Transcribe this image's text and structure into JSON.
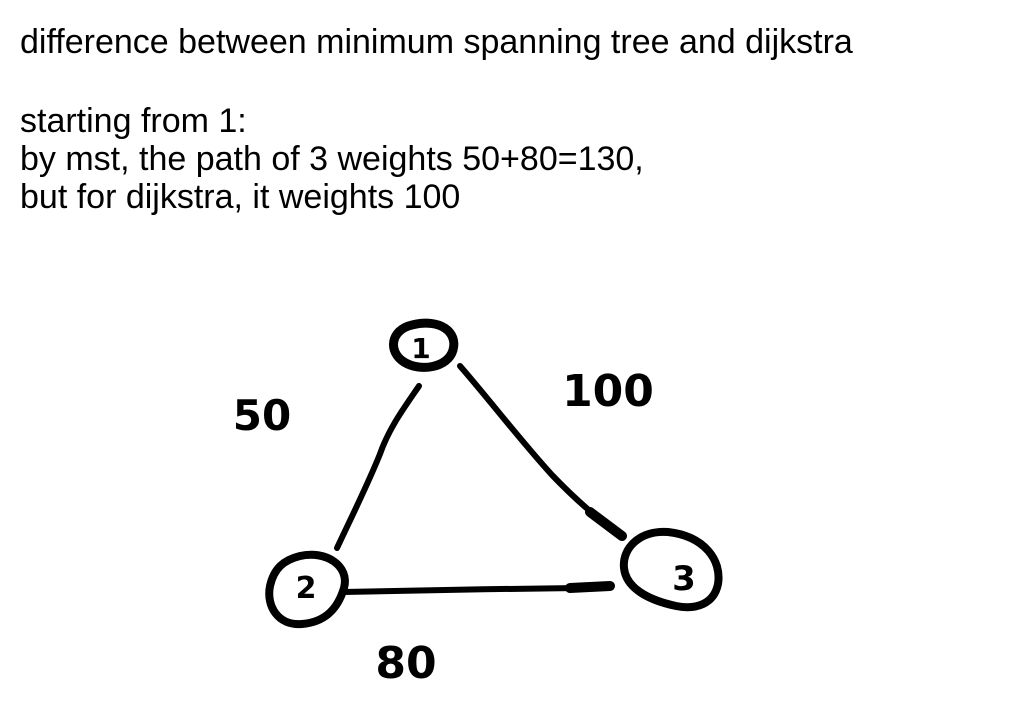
{
  "title": "difference between minimum spanning tree and dijkstra",
  "notes": [
    "starting from 1:",
    "by mst, the path of 3 weights 50+80=130,",
    "but for dijkstra, it weights 100"
  ],
  "graph": {
    "nodes": [
      {
        "id": "1",
        "label": "1"
      },
      {
        "id": "2",
        "label": "2"
      },
      {
        "id": "3",
        "label": "3"
      }
    ],
    "edges": [
      {
        "from": "1",
        "to": "2",
        "weight": "50"
      },
      {
        "from": "1",
        "to": "3",
        "weight": "100"
      },
      {
        "from": "2",
        "to": "3",
        "weight": "80"
      }
    ]
  }
}
